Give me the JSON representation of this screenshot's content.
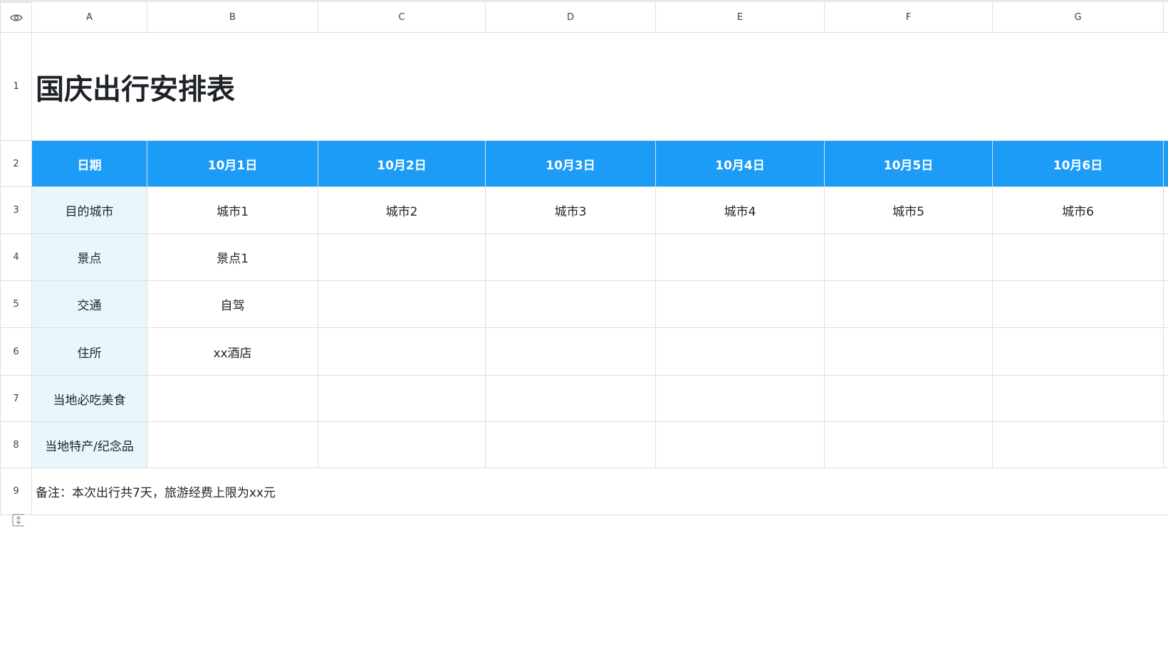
{
  "column_headers": [
    "A",
    "B",
    "C",
    "D",
    "E",
    "F",
    "G"
  ],
  "row_numbers": [
    "1",
    "2",
    "3",
    "4",
    "5",
    "6",
    "7",
    "8",
    "9"
  ],
  "title": "国庆出行安排表",
  "header_row": [
    "日期",
    "10月1日",
    "10月2日",
    "10月3日",
    "10月4日",
    "10月5日",
    "10月6日"
  ],
  "rows": [
    {
      "label": "目的城市",
      "cells": [
        "城市1",
        "城市2",
        "城市3",
        "城市4",
        "城市5",
        "城市6"
      ]
    },
    {
      "label": "景点",
      "cells": [
        "景点1",
        "",
        "",
        "",
        "",
        ""
      ]
    },
    {
      "label": "交通",
      "cells": [
        "自驾",
        "",
        "",
        "",
        "",
        ""
      ]
    },
    {
      "label": "住所",
      "cells": [
        "xx酒店",
        "",
        "",
        "",
        "",
        ""
      ]
    },
    {
      "label": "当地必吃美食",
      "cells": [
        "",
        "",
        "",
        "",
        "",
        ""
      ]
    },
    {
      "label": "当地特产/纪念品",
      "cells": [
        "",
        "",
        "",
        "",
        "",
        ""
      ]
    }
  ],
  "note": "备注：本次出行共7天，旅游经费上限为xx元",
  "icons": {
    "corner": "eye-icon",
    "row_resize": "row-resize-icon"
  },
  "colors": {
    "header_blue": "#1c9cf6",
    "label_bg": "#e9f7fd",
    "grid_line": "#dedede"
  }
}
